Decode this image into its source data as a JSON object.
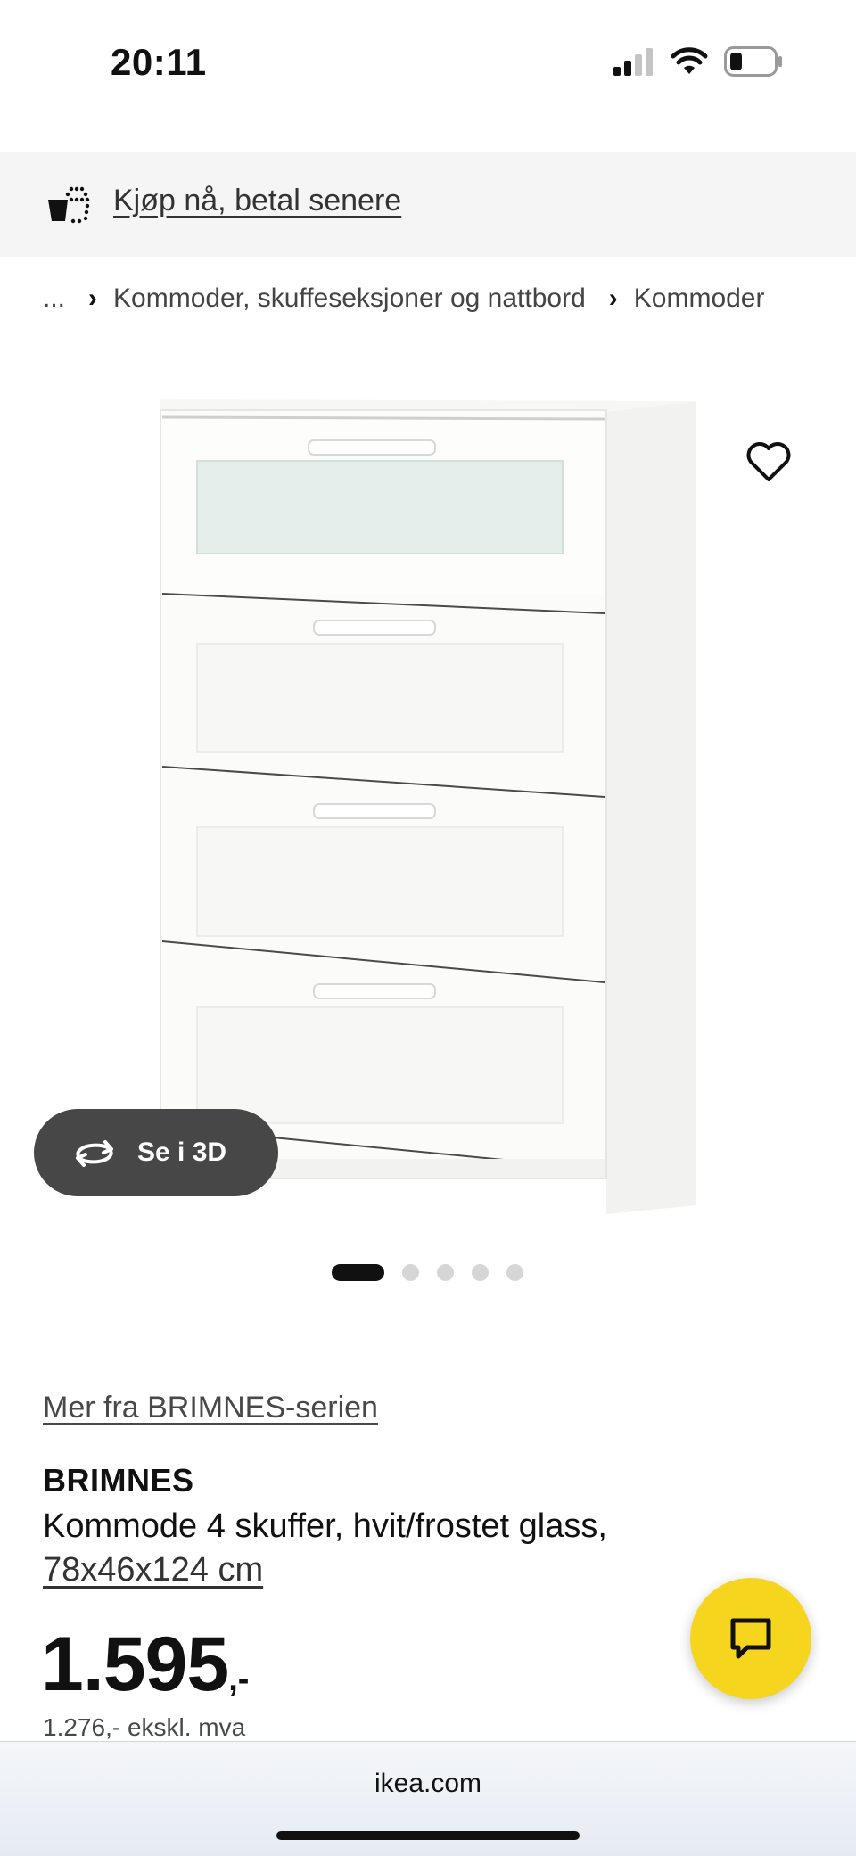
{
  "status_bar": {
    "time": "20:11"
  },
  "promo": {
    "label": "Kjøp nå, betal senere"
  },
  "breadcrumb": {
    "items": [
      "...",
      "Kommoder, skuffeseksjoner og nattbord",
      "Kommoder"
    ]
  },
  "gallery": {
    "view_3d_label": "Se i 3D",
    "image_count": 5,
    "active_index": 0
  },
  "product": {
    "series_link": "Mer fra BRIMNES-serien",
    "name": "BRIMNES",
    "description": "Kommode 4 skuffer, hvit/frostet glass,",
    "size": "78x46x124 cm",
    "price": "1.595",
    "price_suffix": ",-",
    "price_ex_vat": "1.276,- ekskl. mva"
  },
  "browser": {
    "url": "ikea.com"
  },
  "colors": {
    "chat_button": "#f6d51f",
    "promo_bg": "#f5f5f5",
    "view_3d_bg": "#474747"
  }
}
